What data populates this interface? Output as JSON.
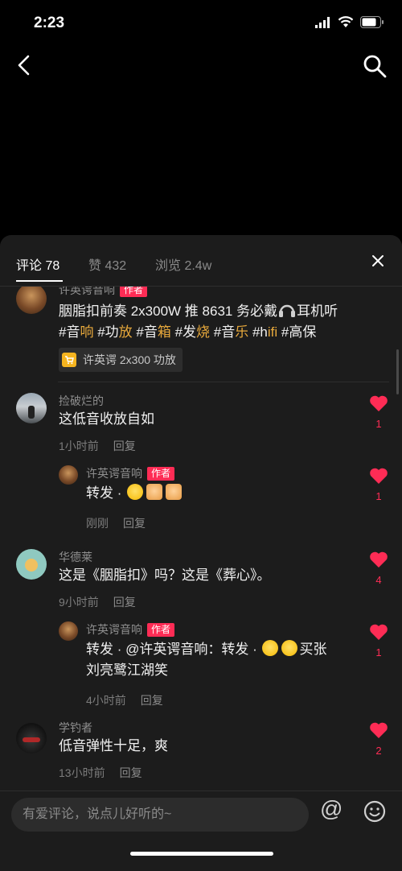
{
  "status_bar": {
    "time": "2:23"
  },
  "tabs": {
    "comments": "评论 78",
    "likes": "赞 432",
    "views": "浏览 2.4w"
  },
  "comments": [
    {
      "user": "许英谔音响",
      "badge": "作者",
      "line1_parts": [
        "胭脂扣前奏 2x300W 推 8631 务必戴",
        "耳机听"
      ],
      "line2_parts": [
        {
          "t": "#音",
          "h": false
        },
        {
          "t": "响",
          "h": true
        },
        {
          "t": " #功",
          "h": false
        },
        {
          "t": "放",
          "h": true
        },
        {
          "t": " #音",
          "h": false
        },
        {
          "t": "箱",
          "h": true
        },
        {
          "t": " #发",
          "h": false
        },
        {
          "t": "烧",
          "h": true
        },
        {
          "t": " #音",
          "h": false
        },
        {
          "t": "乐",
          "h": true
        },
        {
          "t": " #h",
          "h": false
        },
        {
          "t": "ifi",
          "h": true
        },
        {
          "t": " #高保",
          "h": false
        }
      ],
      "product": "许英谔 2x300 功放"
    },
    {
      "user": "捡破烂的",
      "text": "这低音收放自如",
      "time": "1小时前",
      "reply": "回复",
      "likes": "1"
    },
    {
      "user": "许英谔音响",
      "badge": "作者",
      "text": "转发 ·",
      "time": "刚刚",
      "reply": "回复",
      "likes": "1"
    },
    {
      "user": "华德莱",
      "text": "这是《胭脂扣》吗？这是《葬心》。",
      "time": "9小时前",
      "reply": "回复",
      "likes": "4"
    },
    {
      "user": "许英谔音响",
      "badge": "作者",
      "text": "转发 · @许英谔音响：转发 ·",
      "text_end": "买张",
      "text2": "刘亮鹭江湖笑",
      "time": "4小时前",
      "reply": "回复",
      "likes": "1"
    },
    {
      "user": "学钓者",
      "text": "低音弹性十足，爽",
      "time": "13小时前",
      "reply": "回复",
      "likes": "2"
    }
  ],
  "input": {
    "placeholder": "有爱评论，说点儿好听的~"
  },
  "bottom": {
    "at": "@"
  },
  "colors": {
    "accent": "#fe2c55",
    "hashtag": "#e8a93c",
    "sheet": "#1c1c1c"
  }
}
